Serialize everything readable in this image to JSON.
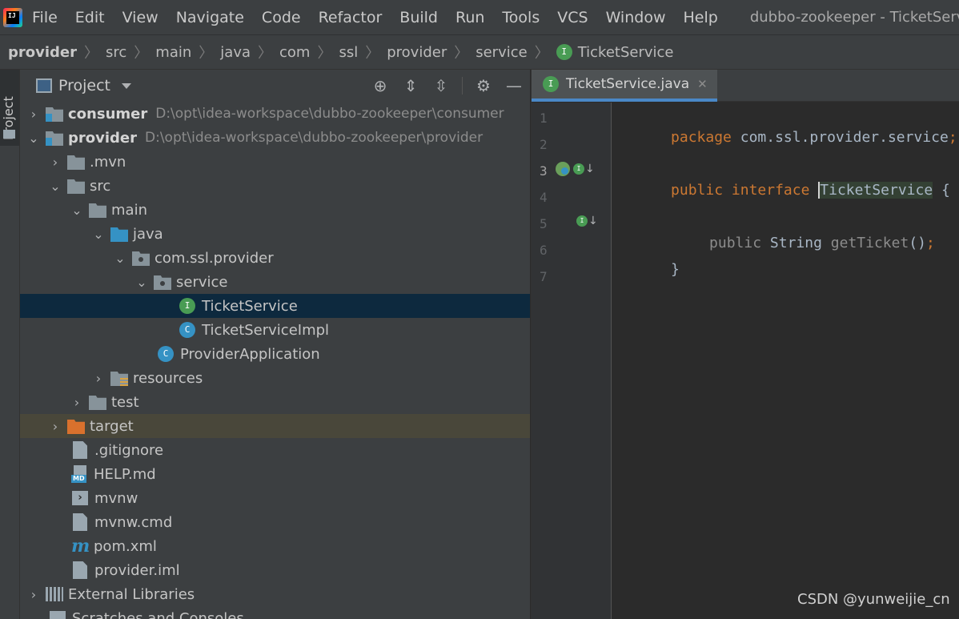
{
  "menubar": {
    "logo_text": "IJ",
    "items": [
      "File",
      "Edit",
      "View",
      "Navigate",
      "Code",
      "Refactor",
      "Build",
      "Run",
      "Tools",
      "VCS",
      "Window",
      "Help"
    ],
    "window_title": "dubbo-zookeeper - TicketService.java (provider)"
  },
  "breadcrumb": {
    "items": [
      "provider",
      "src",
      "main",
      "java",
      "com",
      "ssl",
      "provider",
      "service"
    ],
    "current": "TicketService",
    "current_icon": "interface-icon"
  },
  "toolstrip": {
    "label": "Project"
  },
  "project_panel": {
    "title": "Project",
    "tree": [
      {
        "label": "consumer",
        "path": "D:\\opt\\idea-workspace\\dubbo-zookeeper\\consumer",
        "icon": "module-icon",
        "arrow": "›"
      },
      {
        "label": "provider",
        "path": "D:\\opt\\idea-workspace\\dubbo-zookeeper\\provider",
        "icon": "module-icon",
        "arrow": "⌄"
      },
      {
        "label": ".mvn",
        "icon": "folder-icon",
        "arrow": "›"
      },
      {
        "label": "src",
        "icon": "folder-icon",
        "arrow": "⌄"
      },
      {
        "label": "main",
        "icon": "folder-icon",
        "arrow": "⌄"
      },
      {
        "label": "java",
        "icon": "source-folder-icon",
        "arrow": "⌄"
      },
      {
        "label": "com.ssl.provider",
        "icon": "package-icon",
        "arrow": "⌄"
      },
      {
        "label": "service",
        "icon": "package-icon",
        "arrow": "⌄"
      },
      {
        "label": "TicketService",
        "icon": "interface-icon"
      },
      {
        "label": "TicketServiceImpl",
        "icon": "class-icon"
      },
      {
        "label": "ProviderApplication",
        "icon": "spring-boot-icon"
      },
      {
        "label": "resources",
        "icon": "resources-folder-icon",
        "arrow": "›"
      },
      {
        "label": "test",
        "icon": "folder-icon",
        "arrow": "›"
      },
      {
        "label": "target",
        "icon": "excluded-folder-icon",
        "arrow": "›"
      },
      {
        "label": ".gitignore",
        "icon": "gitignore-icon"
      },
      {
        "label": "HELP.md",
        "icon": "markdown-icon"
      },
      {
        "label": "mvnw",
        "icon": "terminal-icon"
      },
      {
        "label": "mvnw.cmd",
        "icon": "text-file-icon"
      },
      {
        "label": "pom.xml",
        "icon": "maven-icon"
      },
      {
        "label": "provider.iml",
        "icon": "iml-file-icon"
      },
      {
        "label": "External Libraries",
        "icon": "libraries-icon",
        "arrow": "›"
      },
      {
        "label": "Scratches and Consoles",
        "icon": "scratches-icon"
      }
    ]
  },
  "editor": {
    "tab_label": "TicketService.java",
    "line_numbers": [
      "1",
      "2",
      "3",
      "4",
      "5",
      "6",
      "7"
    ],
    "code": {
      "l1_kw": "package",
      "l1_txt": " com.ssl.provider.service",
      "l1_semi": ";",
      "l3_kw1": "public",
      "l3_kw2": "interface",
      "l3_ident": "TicketService",
      "l3_brace": " {",
      "l5_kw": "public",
      "l5_type": " String ",
      "l5_fn": "getTicket",
      "l5_paren": "()",
      "l5_semi": ";",
      "l6_brace": "}"
    }
  },
  "watermark": "CSDN @yunweijie_cn",
  "colors": {
    "keyword": "#cc7832",
    "identifier": "#a9b7c6",
    "interface_icon": "#499c54",
    "class_icon": "#3592c4",
    "selection": "#0d293e",
    "tab_underline": "#4a88c7"
  }
}
